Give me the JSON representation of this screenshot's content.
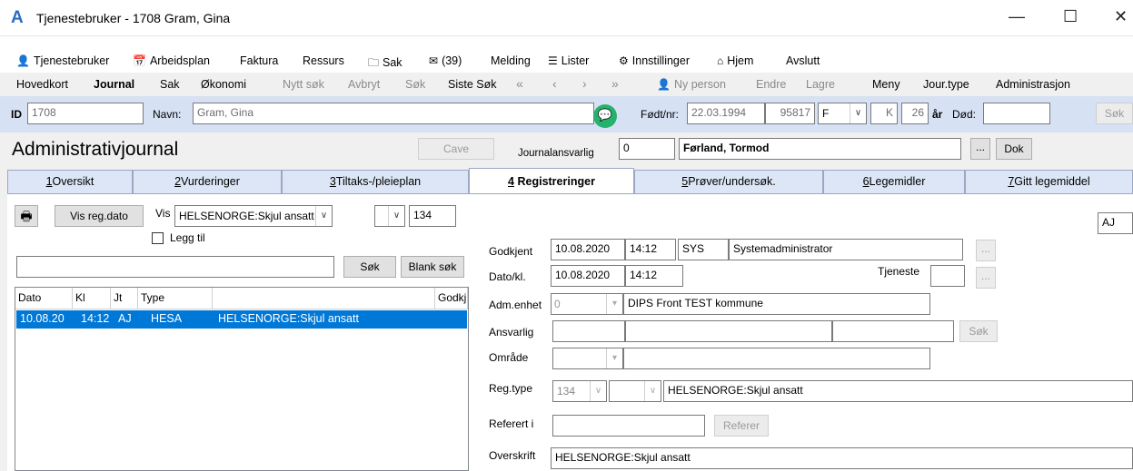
{
  "window": {
    "title": "Tjenestebruker - 1708 Gram, Gina"
  },
  "menu_row1": [
    "Tjenestebruker",
    "Arbeidsplan",
    "Faktura",
    "Ressurs",
    "Sak",
    "(39)",
    "Melding",
    "Lister",
    "Innstillinger",
    "Hjem",
    "Avslutt"
  ],
  "menu_row2": [
    "Hovedkort",
    "Journal",
    "Sak",
    "Økonomi",
    "Nytt søk",
    "Avbryt",
    "Søk",
    "Siste Søk",
    "Ny person",
    "Endre",
    "Lagre",
    "Meny",
    "Jour.type",
    "Administrasjon"
  ],
  "patient": {
    "id_label": "ID",
    "id": "1708",
    "name_label": "Navn:",
    "name": "Gram, Gina",
    "dob_label": "Født/nr:",
    "dob": "22.03.1994",
    "pnr": "95817",
    "sex": "F",
    "k": "K",
    "age": "26",
    "age_unit": "år",
    "dod_label": "Død:",
    "dod": "",
    "search_btn": "Søk"
  },
  "heading": {
    "title": "Administrativjournal",
    "cave": "Cave",
    "resp_label": "Journalansvarlig",
    "resp_id": "0",
    "resp_name": "Førland, Tormod",
    "ellipsis": "...",
    "dok": "Dok"
  },
  "tabs": [
    {
      "num": "1",
      "label": "Oversikt"
    },
    {
      "num": "2",
      "label": "Vurderinger"
    },
    {
      "num": "3",
      "label": "Tiltaks-/pleieplan"
    },
    {
      "num": "4",
      "label": "Registreringer"
    },
    {
      "num": "5",
      "label": "Prøver/undersøk."
    },
    {
      "num": "6",
      "label": "Legemidler"
    },
    {
      "num": "7",
      "label": "Gitt legemiddel"
    }
  ],
  "left": {
    "vis_reg_btn": "Vis reg.dato",
    "vis_label": "Vis",
    "vis_value": "HELSENORGE:Skjul ansatt",
    "code": "134",
    "legg_til": "Legg til",
    "sok": "Søk",
    "blank_sok": "Blank søk",
    "columns": [
      "Dato",
      "Kl",
      "Jt",
      "Type",
      "",
      "Godkj"
    ],
    "rows": [
      {
        "dato": "10.08.20",
        "kl": "14:12",
        "jt": "AJ",
        "type": "HESA",
        "desc": "HELSENORGE:Skjul ansatt",
        "godkj": ""
      }
    ]
  },
  "form": {
    "aj": "AJ",
    "godkjent_label": "Godkjent",
    "godkjent_date": "10.08.2020",
    "godkjent_time": "14:12",
    "godkjent_user": "SYS",
    "godkjent_name": "Systemadministrator",
    "dato_label": "Dato/kl.",
    "dato_date": "10.08.2020",
    "dato_time": "14:12",
    "tjeneste_label": "Tjeneste",
    "adm_label": "Adm.enhet",
    "adm_code": "0",
    "adm_name": "DIPS Front TEST kommune",
    "ansvarlig_label": "Ansvarlig",
    "ansvarlig_sok": "Søk",
    "omrade_label": "Område",
    "regtype_label": "Reg.type",
    "regtype_code": "134",
    "regtype_name": "HELSENORGE:Skjul ansatt",
    "referert_label": "Referert i",
    "referer_btn": "Referer",
    "overskrift_label": "Overskrift",
    "overskrift": "HELSENORGE:Skjul ansatt",
    "ellipsis": "..."
  }
}
